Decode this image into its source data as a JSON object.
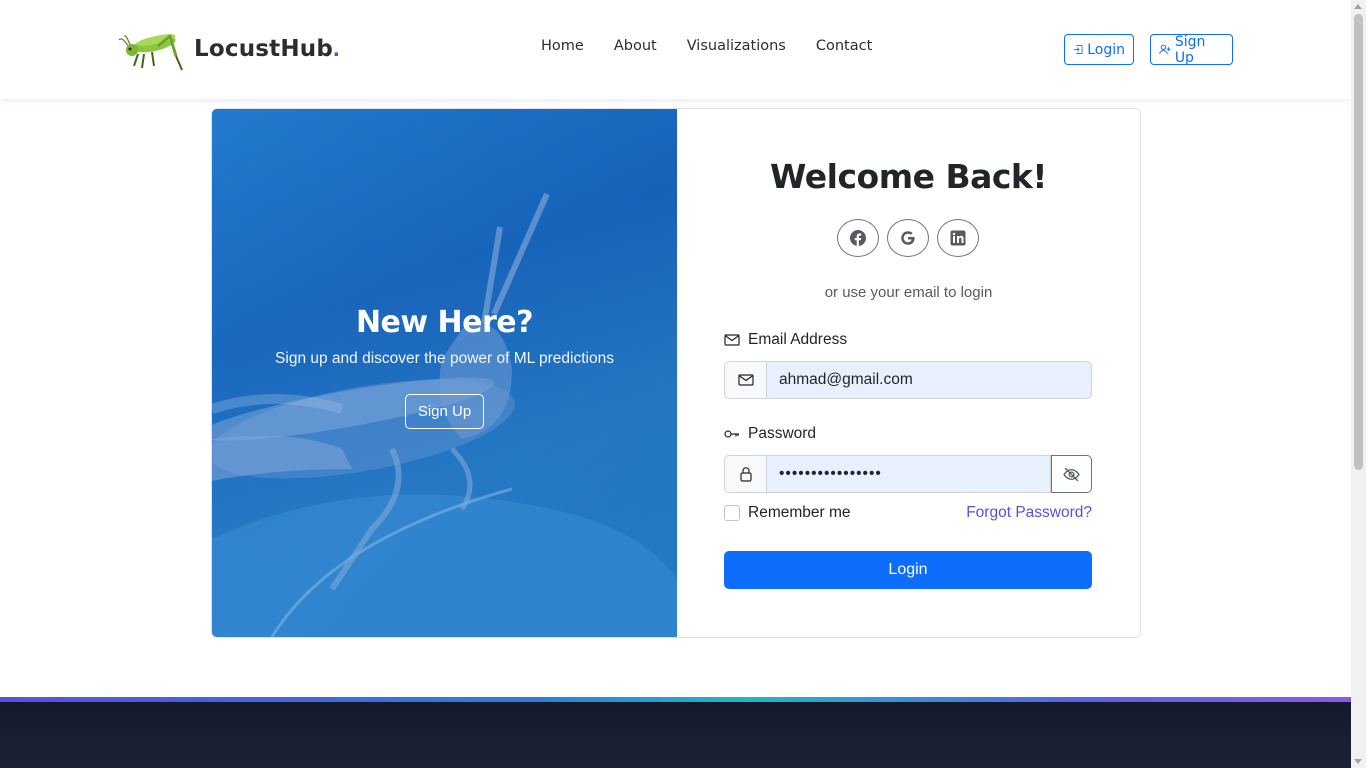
{
  "brand": {
    "name": "LocustHub",
    "dot": ".",
    "logo_icon": "grasshopper-icon"
  },
  "nav": {
    "links": [
      "Home",
      "About",
      "Visualizations",
      "Contact"
    ],
    "login_label": "Login",
    "signup_label": "Sign Up"
  },
  "left_panel": {
    "title": "New Here?",
    "subtitle": "Sign up and discover the power of ML predictions",
    "button": "Sign Up"
  },
  "form": {
    "title": "Welcome Back!",
    "socials": [
      "facebook-icon",
      "google-icon",
      "linkedin-icon"
    ],
    "or_text": "or use your email to login",
    "email_label": "Email Address",
    "email_value": "ahmad@gmail.com",
    "password_label": "Password",
    "password_value": "••••••••••••••••",
    "remember_label": "Remember me",
    "forgot_label": "Forgot Password?",
    "submit_label": "Login"
  },
  "colors": {
    "primary": "#0d6efd",
    "accent": "#5b4fe0",
    "footer": "#141a2b"
  }
}
